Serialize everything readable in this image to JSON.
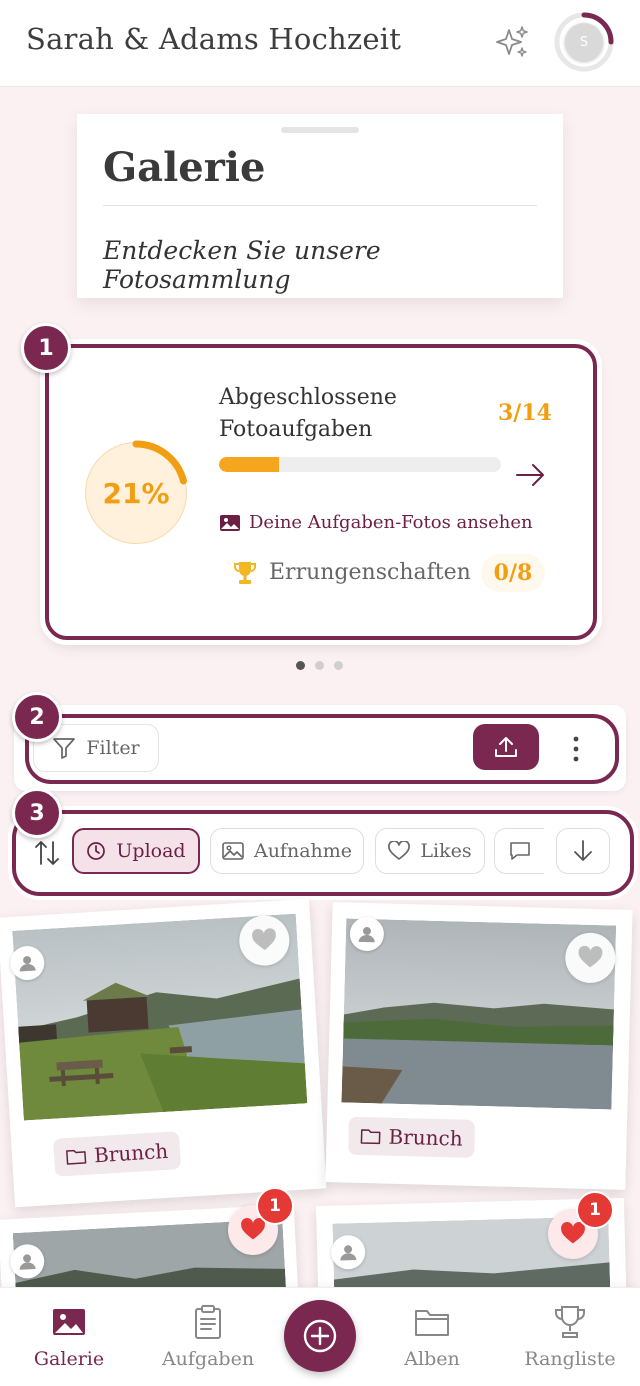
{
  "header": {
    "title": "Sarah & Adams Hochzeit",
    "avatar_initial": "S",
    "sparkle_icon": "sparkle-icon"
  },
  "gallery": {
    "title": "Galerie",
    "subtitle": "Entdecken Sie unsere Fotosammlung"
  },
  "tour_badges": [
    "1",
    "2",
    "3"
  ],
  "progress_card": {
    "percent_label": "21%",
    "percent_value": 21,
    "title": "Abgeschlossene Fotoaufgaben",
    "count": "3/14",
    "bar_fraction": 0.214,
    "photos_link": "Deine Aufgaben-Fotos ansehen",
    "achievements_label": "Errungenschaften",
    "achievements_count": "0/8",
    "accent_color": "#f29e12",
    "brand_color": "#7a2850"
  },
  "carousel": {
    "pages": 3,
    "active": 0
  },
  "toolbar": {
    "filter_label": "Filter"
  },
  "sort": {
    "chips": [
      {
        "label": "Upload",
        "icon": "clock-icon",
        "active": true
      },
      {
        "label": "Aufnahme",
        "icon": "image-icon",
        "active": false
      },
      {
        "label": "Likes",
        "icon": "heart-outline-icon",
        "active": false
      }
    ]
  },
  "photos": [
    {
      "album": "Brunch",
      "liked": false,
      "likes": ""
    },
    {
      "album": "Brunch",
      "liked": false,
      "likes": ""
    },
    {
      "album": "",
      "liked": true,
      "likes": "1"
    },
    {
      "album": "",
      "liked": true,
      "likes": "1"
    }
  ],
  "bottom_nav": {
    "items": [
      {
        "label": "Galerie",
        "icon": "gallery-icon",
        "active": true
      },
      {
        "label": "Aufgaben",
        "icon": "clipboard-icon",
        "active": false
      },
      {
        "label": "Alben",
        "icon": "folder-icon",
        "active": false
      },
      {
        "label": "Rangliste",
        "icon": "trophy-icon",
        "active": false
      }
    ]
  }
}
